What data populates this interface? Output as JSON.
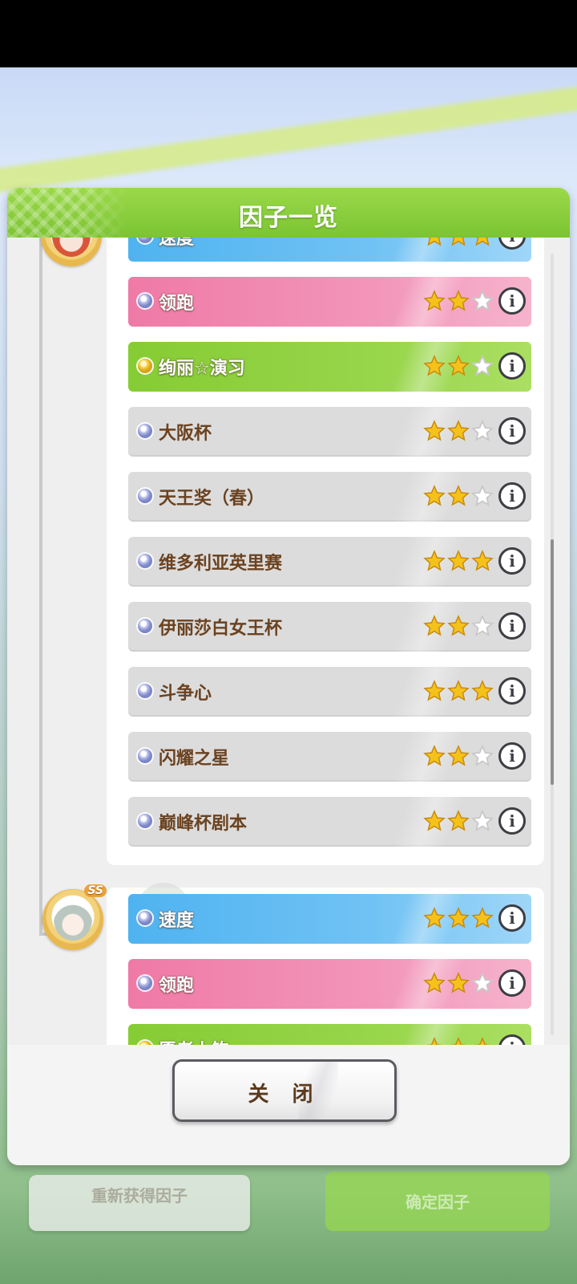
{
  "dialog": {
    "title": "因子一览",
    "close_label": "关 闭"
  },
  "background": {
    "left_button_label": "重新获得因子",
    "right_button_label": "确定因子"
  },
  "groups": [
    {
      "avatar": "character-portrait-1",
      "factors": [
        {
          "label": "速度",
          "type": "blue",
          "stars": 3,
          "dot": "silver"
        },
        {
          "label": "领跑",
          "type": "pink",
          "stars": 2,
          "dot": "silver"
        },
        {
          "label": "绚丽☆演习",
          "type": "green",
          "stars": 2,
          "dot": "gold"
        },
        {
          "label": "大阪杯",
          "type": "grey",
          "stars": 2,
          "dot": "silver"
        },
        {
          "label": "天王奖（春）",
          "type": "grey",
          "stars": 2,
          "dot": "silver"
        },
        {
          "label": "维多利亚英里赛",
          "type": "grey",
          "stars": 3,
          "dot": "silver"
        },
        {
          "label": "伊丽莎白女王杯",
          "type": "grey",
          "stars": 2,
          "dot": "silver"
        },
        {
          "label": "斗争心",
          "type": "grey",
          "stars": 3,
          "dot": "silver"
        },
        {
          "label": "闪耀之星",
          "type": "grey",
          "stars": 2,
          "dot": "silver"
        },
        {
          "label": "巅峰杯剧本",
          "type": "grey",
          "stars": 2,
          "dot": "silver"
        }
      ]
    },
    {
      "avatar": "character-portrait-2",
      "badge": "SS",
      "factors": [
        {
          "label": "速度",
          "type": "blue",
          "stars": 3,
          "dot": "silver"
        },
        {
          "label": "领跑",
          "type": "pink",
          "stars": 2,
          "dot": "silver"
        },
        {
          "label": "愿者上钩",
          "type": "green",
          "stars": 3,
          "dot": "gold"
        }
      ]
    }
  ],
  "icons": {
    "info": "i",
    "star_filled_color": "#f5c21b",
    "star_empty_color": "#c8c8c8"
  }
}
